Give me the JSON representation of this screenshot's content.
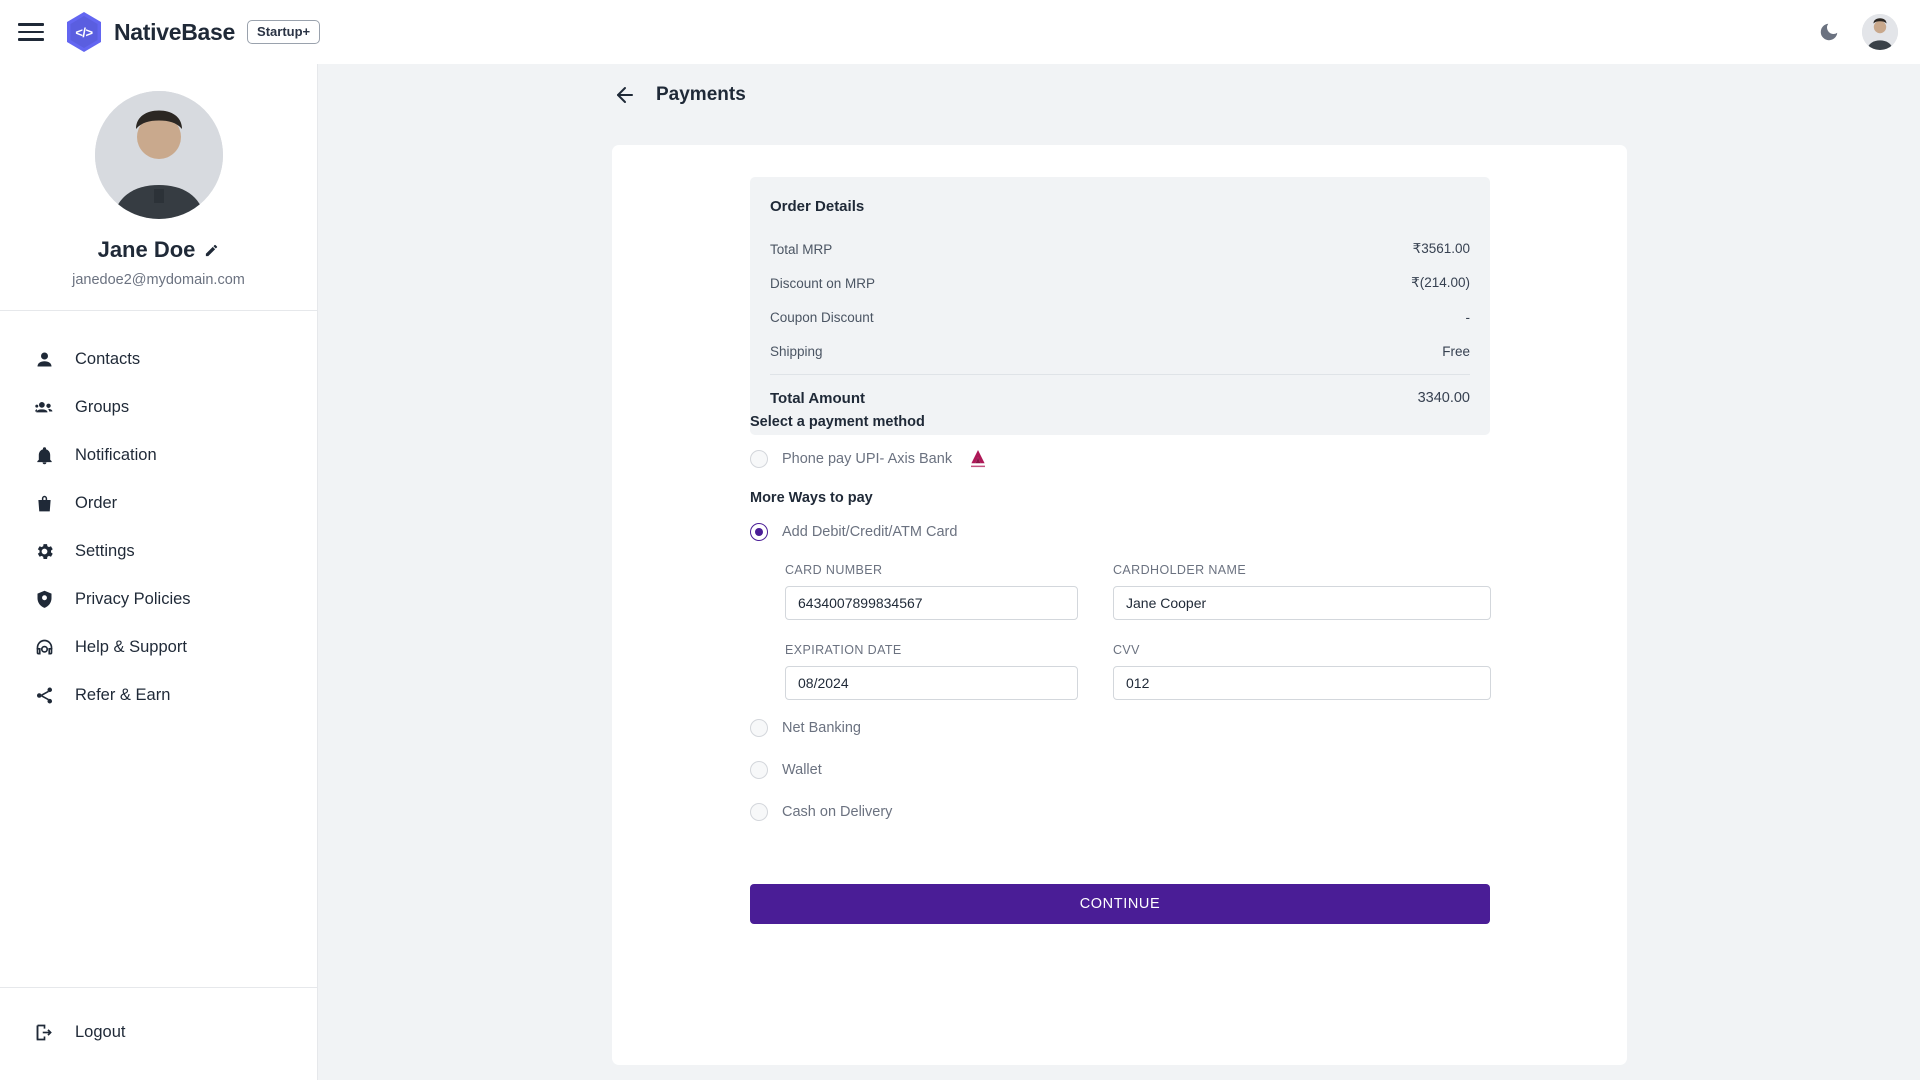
{
  "topbar": {
    "menu_icon": "hamburger-icon",
    "logo_icon": "nativebase-hexagon-logo",
    "logo_glyph": "</>",
    "brand_name": "NativeBase",
    "plan_badge": "Startup+",
    "theme_toggle_icon": "moon-icon",
    "avatar_icon": "user-avatar"
  },
  "sidebar": {
    "profile": {
      "avatar_icon": "profile-avatar",
      "name": "Jane Doe",
      "edit_icon": "pencil-icon",
      "email": "janedoe2@mydomain.com"
    },
    "items": [
      {
        "label": "Contacts",
        "icon": "person-icon"
      },
      {
        "label": "Groups",
        "icon": "people-icon"
      },
      {
        "label": "Notification",
        "icon": "bell-icon"
      },
      {
        "label": "Order",
        "icon": "shopping-bag-icon"
      },
      {
        "label": "Settings",
        "icon": "gear-icon"
      },
      {
        "label": "Privacy Policies",
        "icon": "shield-icon"
      },
      {
        "label": "Help & Support",
        "icon": "headset-icon"
      },
      {
        "label": "Refer & Earn",
        "icon": "share-icon"
      }
    ],
    "logout": {
      "label": "Logout",
      "icon": "logout-icon"
    }
  },
  "page": {
    "back_icon": "arrow-left-icon",
    "title": "Payments"
  },
  "order_details": {
    "title": "Order Details",
    "rows": [
      {
        "label": "Total MRP",
        "value": "₹3561.00"
      },
      {
        "label": "Discount on MRP",
        "value": "₹(214.00)"
      },
      {
        "label": "Coupon Discount",
        "value": "-"
      },
      {
        "label": "Shipping",
        "value": "Free"
      }
    ],
    "total": {
      "label": "Total Amount",
      "value": "3340.00"
    }
  },
  "payment": {
    "select_title": "Select a payment method",
    "upi_option": {
      "label": "Phone pay UPI- Axis Bank",
      "selected": false,
      "logo_icon": "axis-bank-logo"
    },
    "more_title": "More Ways to pay",
    "card_option": {
      "label": "Add Debit/Credit/ATM Card",
      "selected": true
    },
    "fields": {
      "card_number": {
        "label": "CARD NUMBER",
        "value": "6434007899834567"
      },
      "cardholder_name": {
        "label": "CARDHOLDER NAME",
        "value": "Jane Cooper"
      },
      "expiration_date": {
        "label": "EXPIRATION DATE",
        "value": "08/2024"
      },
      "cvv": {
        "label": "CVV",
        "value": "012"
      }
    },
    "other_options": [
      {
        "label": "Net Banking",
        "selected": false
      },
      {
        "label": "Wallet",
        "selected": false
      },
      {
        "label": "Cash on Delivery",
        "selected": false
      }
    ],
    "continue_label": "CONTINUE"
  },
  "colors": {
    "accent_purple": "#4A1D96",
    "logo_blue": "#5A5EE0",
    "axis_crimson": "#AE1857",
    "page_bg": "#F1F3F5",
    "text_dark": "#1F2937",
    "text_muted": "#6B7280"
  }
}
